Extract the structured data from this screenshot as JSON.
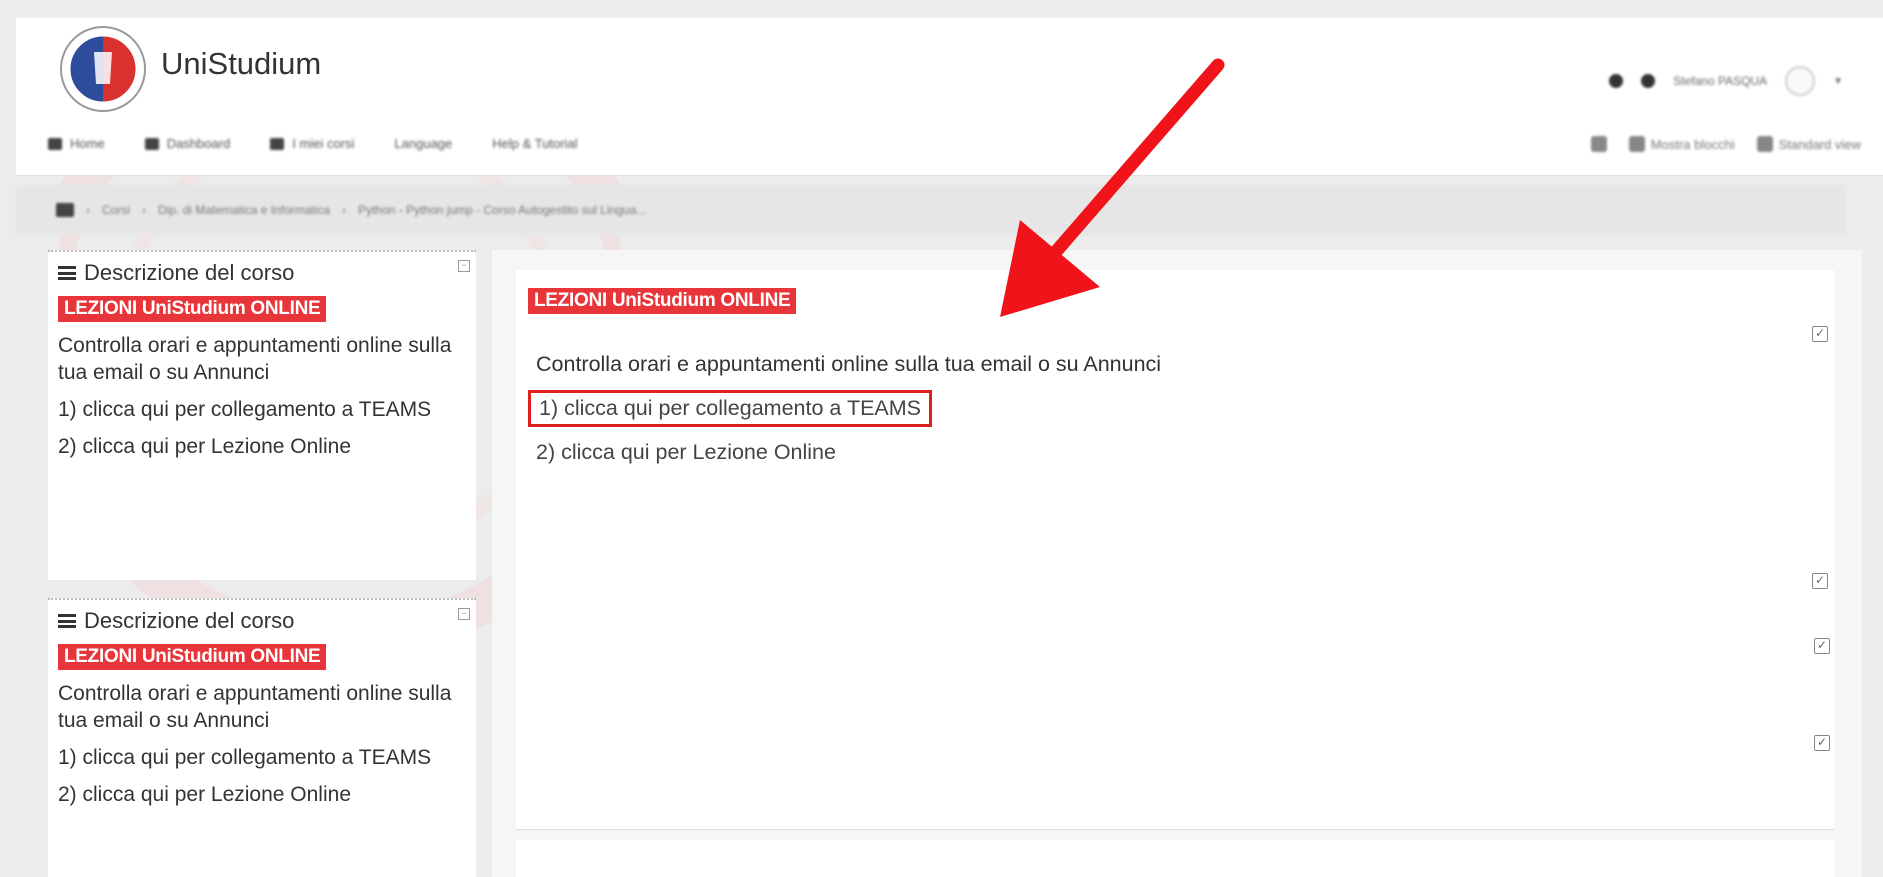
{
  "header": {
    "site_name": "UniStudium",
    "user_name": "Stefano PASQUA",
    "nav": [
      "Home",
      "Dashboard",
      "I miei corsi",
      "Language",
      "Help & Tutorial"
    ],
    "nav_right": [
      "Mostra blocchi",
      "Standard view"
    ]
  },
  "breadcrumb": [
    "Corsi",
    "Dip. di Matematica e Informatica",
    "Python - Python jump - Corso Autogestito sul Lingua..."
  ],
  "left_blocks": [
    {
      "title": "Descrizione del corso",
      "label": "LEZIONI UniStudium ONLINE",
      "desc": "Controlla orari e appuntamenti online sulla tua email o su Annunci",
      "link1": "1) clicca qui per collegamento a TEAMS",
      "link2": "2) clicca qui per Lezione Online"
    },
    {
      "title": "Descrizione del corso",
      "label": "LEZIONI UniStudium ONLINE",
      "desc": "Controlla orari e appuntamenti online sulla tua email o su Annunci",
      "link1": "1) clicca qui per collegamento a TEAMS",
      "link2": "2) clicca qui per Lezione Online"
    }
  ],
  "main": {
    "label": "LEZIONI UniStudium ONLINE",
    "desc": "Controlla orari e appuntamenti online sulla tua email o su Annunci",
    "link_teams": "1) clicca qui per collegamento a TEAMS",
    "link_online": "2) clicca qui per Lezione Online"
  },
  "colors": {
    "label_red": "#e8353a",
    "highlight_red": "#e0201f",
    "arrow_red": "#f0141a"
  },
  "icons": [
    "bell-icon",
    "chat-icon",
    "menu-icon",
    "collapse-icon",
    "checkbox-icon",
    "arrow-annotation"
  ]
}
